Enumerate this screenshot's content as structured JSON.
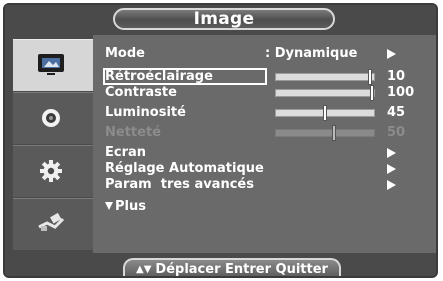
{
  "title": "Image",
  "sidebar": {
    "items": [
      {
        "icon": "picture-icon",
        "active": true
      },
      {
        "icon": "sound-icon",
        "active": false
      },
      {
        "icon": "setup-gear-icon",
        "active": false
      },
      {
        "icon": "input-plug-icon",
        "active": false
      }
    ]
  },
  "menu": {
    "mode": {
      "label": "Mode",
      "value": ": Dynamique"
    },
    "retroeclairage": {
      "label": "Rétroéclairage",
      "value": "10",
      "level": 0.98
    },
    "contraste": {
      "label": "Contraste",
      "value": "100",
      "level": 1.0
    },
    "luminosite": {
      "label": "Luminosité",
      "value": "45",
      "level": 0.5
    },
    "nettete": {
      "label": "Netteté",
      "value": "50",
      "level": 0.6
    },
    "ecran": {
      "label": "Ecran"
    },
    "reglage": {
      "label": "Réglage Automatique"
    },
    "parametres": {
      "label": "Param  tres avancés"
    },
    "plus": {
      "label": "Plus"
    }
  },
  "footer": {
    "move": "Déplacer",
    "enter": "Entrer",
    "quit": "Quitter"
  },
  "colors": {
    "background": "#4a4a4a",
    "panel": "#6a6a6a",
    "active_tab": "#d6d6d6",
    "text": "#ffffff",
    "disabled_text": "#8c8c8c"
  }
}
